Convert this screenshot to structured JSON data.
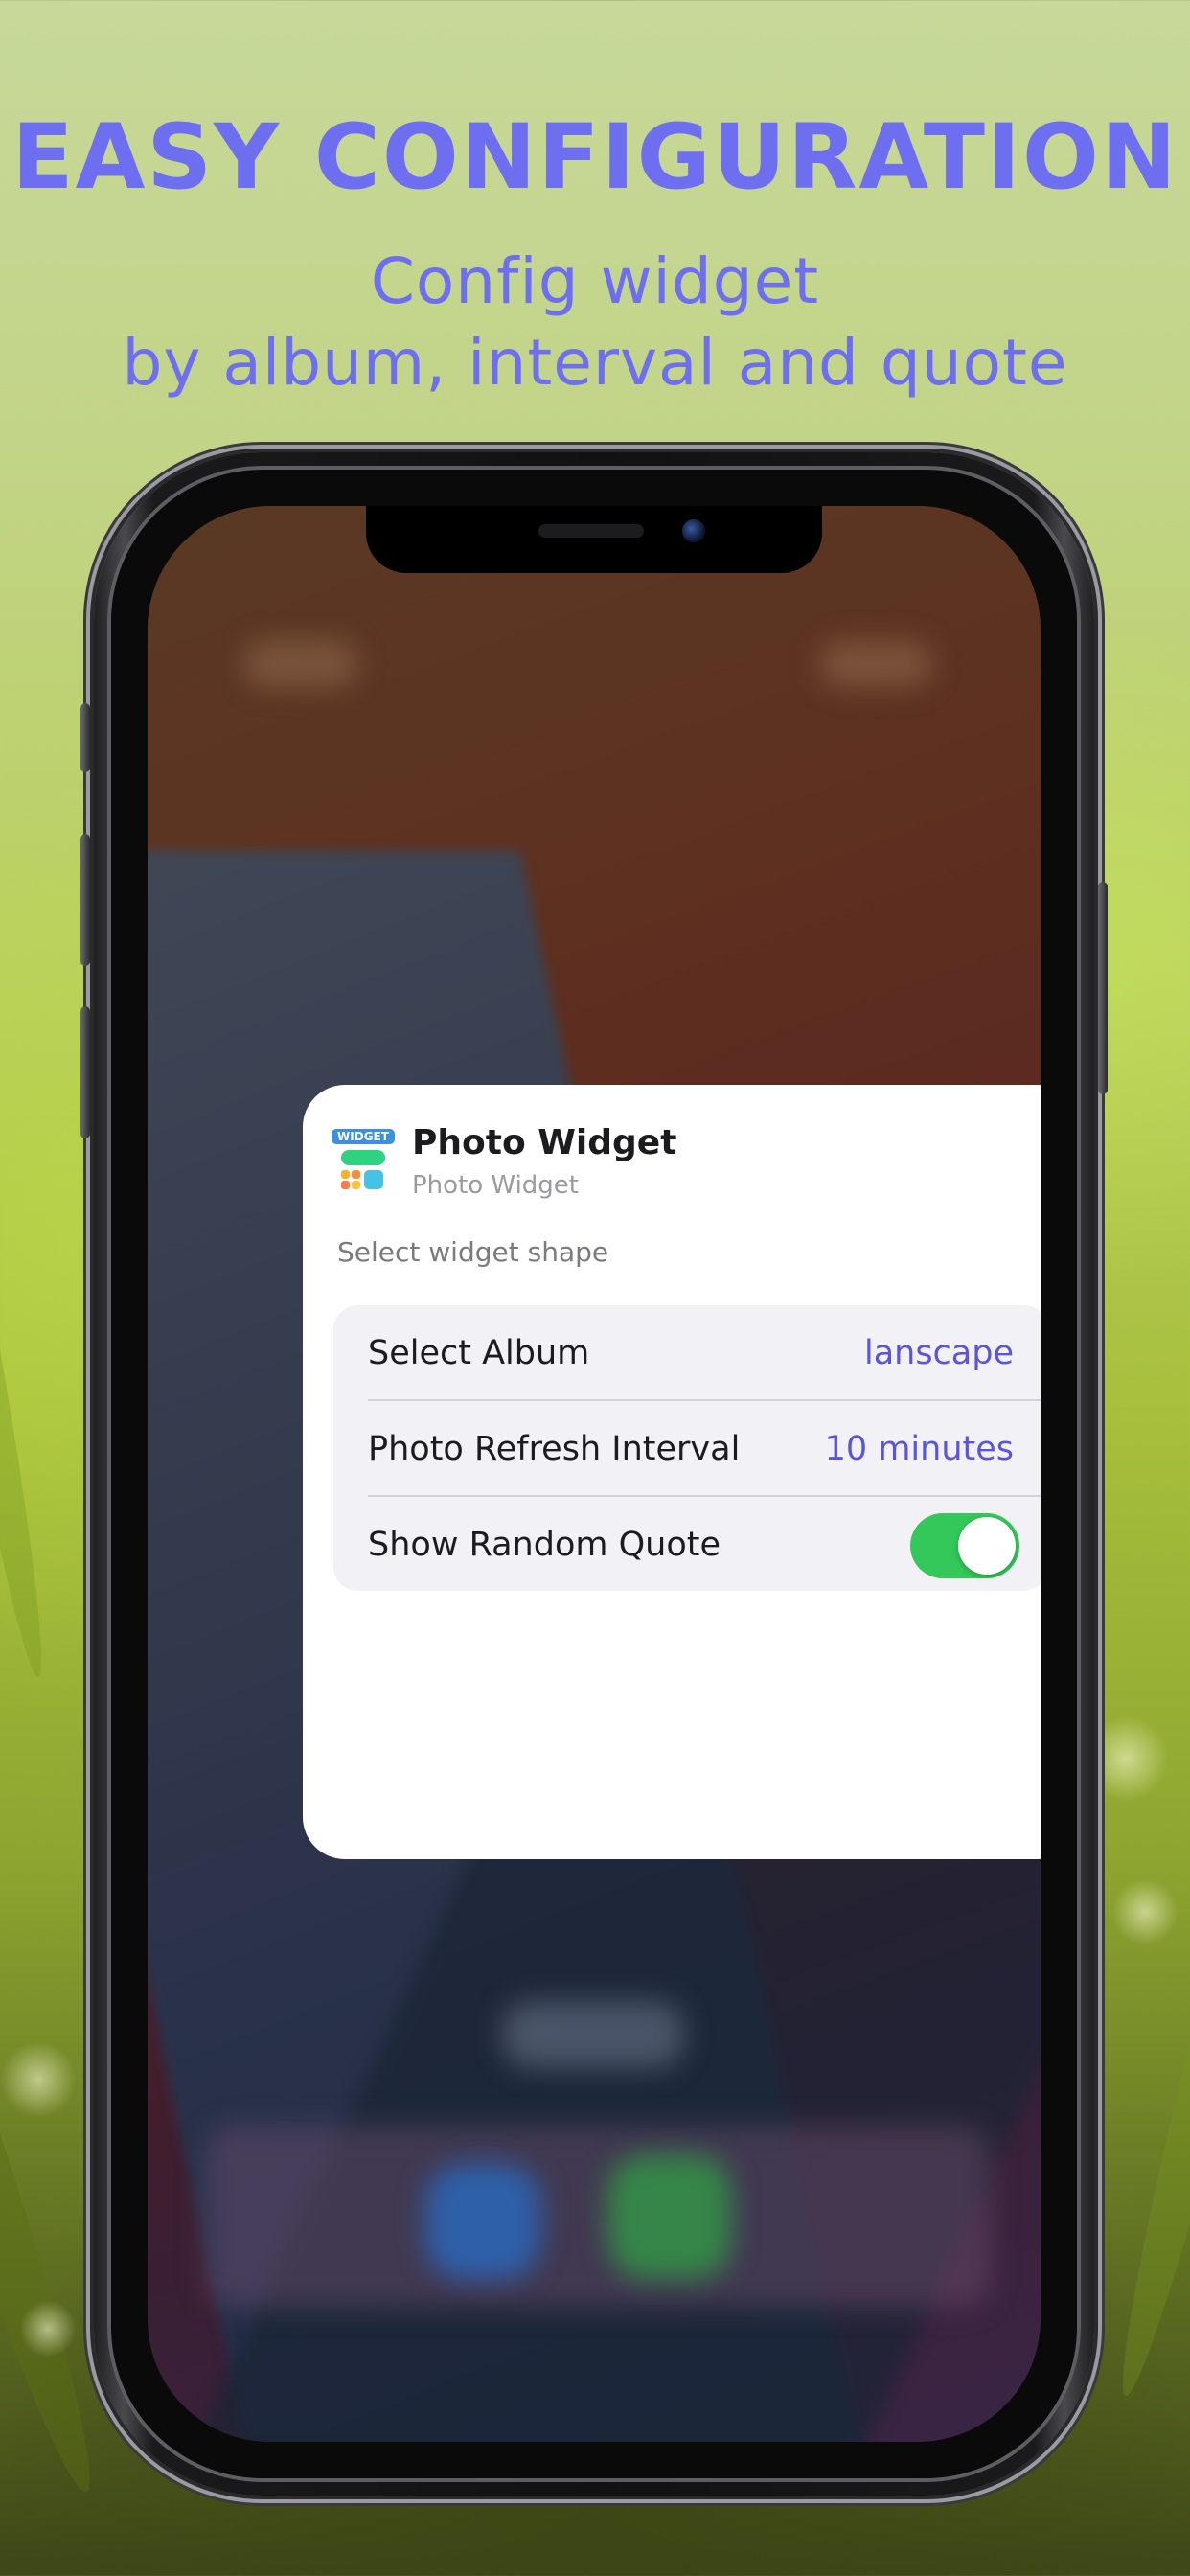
{
  "headline": "EASY CONFIGURATION",
  "subheadline": {
    "line1": "Config widget",
    "line2": "by album, interval and quote"
  },
  "widget_config": {
    "app_name": "Photo Widget",
    "app_subtitle": "Photo Widget",
    "app_icon_tag": "WIDGET",
    "section_hint": "Select widget shape",
    "settings": [
      {
        "label": "Select Album",
        "value": "lanscape"
      },
      {
        "label": "Photo Refresh Interval",
        "value": "10 minutes"
      },
      {
        "label": "Show Random Quote",
        "toggle_on": true
      }
    ]
  },
  "colors": {
    "accent": "#6e6ff0",
    "value_text": "#5a55d9",
    "toggle_on": "#34c759"
  }
}
